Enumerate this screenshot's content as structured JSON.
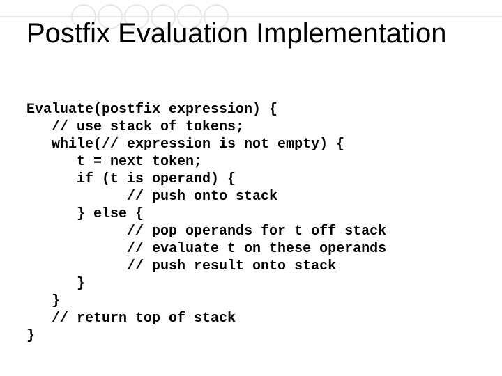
{
  "title": "Postfix Evaluation Implementation",
  "code": {
    "l0": "Evaluate(postfix expression) {",
    "l1": "   // use stack of tokens;",
    "l2": "   while(// expression is not empty) {",
    "l3": "      t = next token;",
    "l4": "      if (t is operand) {",
    "l5": "            // push onto stack",
    "l6": "      } else {",
    "l7": "            // pop operands for t off stack",
    "l8": "            // evaluate t on these operands",
    "l9": "            // push result onto stack",
    "l10": "      }",
    "l11": "   }",
    "l12": "   // return top of stack",
    "l13": "}"
  }
}
